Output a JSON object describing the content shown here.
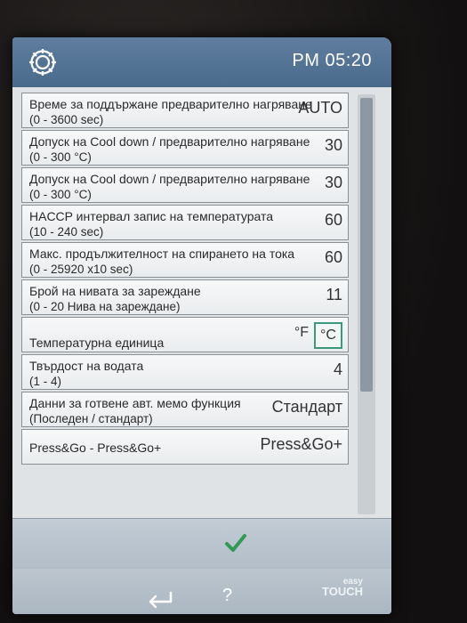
{
  "header": {
    "clock": "PM 05:20",
    "settings_icon": "gear-icon"
  },
  "settings": [
    {
      "name": "Време за поддържане предварително нагряване",
      "range": "(0 - 3600 sec)",
      "value": "AUTO"
    },
    {
      "name": "Допуск на Cool down / предварително нагряване",
      "range": "(0 - 300 °C)",
      "value": "30"
    },
    {
      "name": "Допуск на Cool down / предварително нагряване",
      "range": "(0 - 300 °C)",
      "value": "30"
    },
    {
      "name": "HACCP интервал запис на температурата",
      "range": "(10 - 240 sec)",
      "value": "60"
    },
    {
      "name": "Макс. продължителност на спирането на тока",
      "range": "(0 - 25920 x10 sec)",
      "value": "60"
    },
    {
      "name": "Брой на нивата за зареждане",
      "range": "(0 - 20 Нива на зареждане)",
      "value": "11"
    }
  ],
  "temperature_unit": {
    "name": "Температурна единица",
    "option_f": "°F",
    "option_c": "°C",
    "selected": "°C"
  },
  "settings2": [
    {
      "name": "Твърдост на водата",
      "range": "(1 - 4)",
      "value": "4"
    },
    {
      "name": "Данни за готвене авт. мемо функция",
      "range": "(Последен / стандарт)",
      "value": "Стандарт"
    }
  ],
  "press_go": {
    "name": "Press&Go - Press&Go+",
    "value": "Press&Go+"
  },
  "footer": {
    "confirm_icon": "checkmark-icon",
    "back_icon": "back-arrow-icon",
    "help_label": "?",
    "brand_line1": "easy",
    "brand_line2": "TOUCH"
  },
  "colors": {
    "header": "#4a6a8c",
    "accent_selected": "#3a9a7c",
    "confirm": "#2f9a56"
  }
}
